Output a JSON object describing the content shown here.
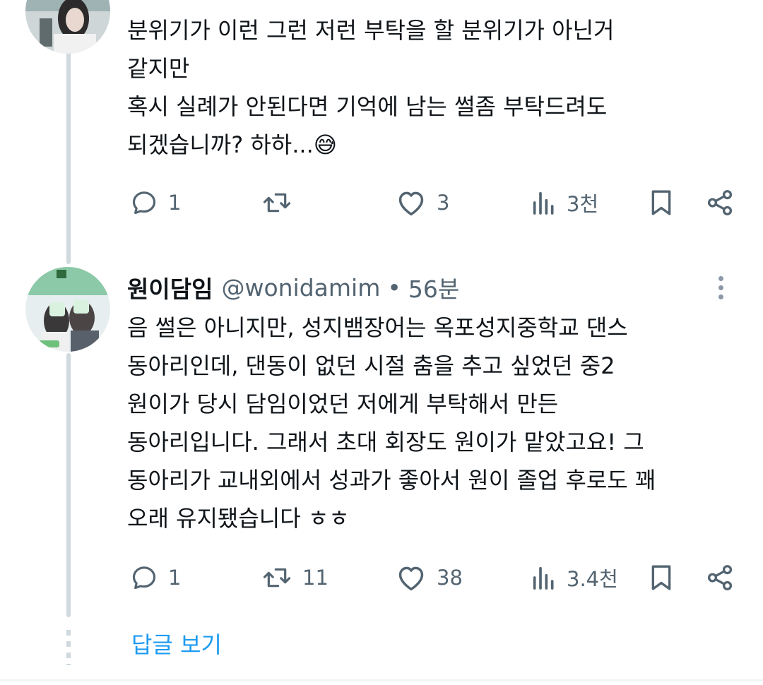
{
  "tweet1": {
    "text_lines": [
      "분위기가 이런 그런 저런 부탁을 할 분위기가 아닌거",
      "같지만",
      "혹시 실례가 안된다면 기억에 남는 썰좀 부탁드려도",
      "되겠습니까? 하하...😅"
    ],
    "replies": "1",
    "retweets": "",
    "likes": "3",
    "views": "3천"
  },
  "tweet2": {
    "display_name": "원이담임",
    "handle": "@wonidamim",
    "separator": "•",
    "time": "56분",
    "text_lines": [
      "음 썰은 아니지만, 성지뱀장어는 옥포성지중학교 댄스",
      "동아리인데, 댄동이 없던 시절 춤을 추고 싶었던 중2",
      "원이가 당시 담임이었던 저에게 부탁해서 만든",
      "동아리입니다. 그래서 초대 회장도 원이가 맡았고요! 그",
      "동아리가 교내외에서 성과가 좋아서 원이 졸업 후로도 꽤",
      "오래 유지됐습니다 ㅎㅎ"
    ],
    "replies": "1",
    "retweets": "11",
    "likes": "38",
    "views": "3.4천"
  },
  "show_replies_label": "답글 보기",
  "icons": {
    "reply": "reply-icon",
    "retweet": "retweet-icon",
    "like": "heart-icon",
    "views": "views-icon",
    "bookmark": "bookmark-icon",
    "share": "share-icon",
    "more": "more-icon"
  },
  "colors": {
    "text": "#0f1419",
    "secondary": "#536471",
    "link": "#1d9bf0",
    "thread_line": "#cfd9de"
  }
}
